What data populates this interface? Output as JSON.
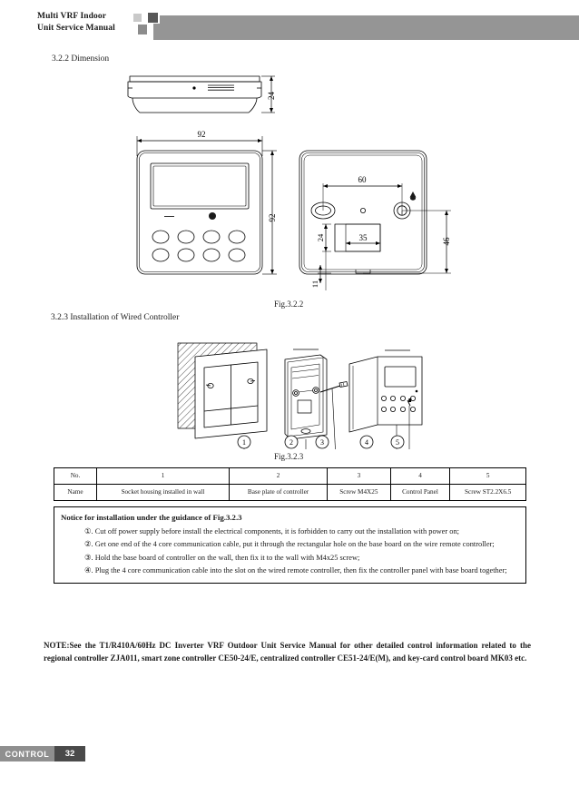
{
  "header": {
    "title_line1": "Multi VRF Indoor",
    "title_line2": "Unit Service Manual"
  },
  "sections": {
    "dimension_heading": "3.2.2 Dimension",
    "installation_heading": "3.2.3 Installation of Wired Controller"
  },
  "figures": {
    "fig_322_caption": "Fig.3.2.2",
    "fig_323_caption": "Fig.3.2.3"
  },
  "dimensions": {
    "side_thickness": "24",
    "front_width": "92",
    "front_height": "92",
    "back_hole_spacing": "60",
    "back_rect_width": "35",
    "back_rect_offset_top": "24",
    "back_right_height": "46",
    "back_bottom_offset": "11"
  },
  "callouts": [
    "1",
    "2",
    "3",
    "4",
    "5"
  ],
  "parts_table": {
    "row_no_label": "No.",
    "row_name_label": "Name",
    "numbers": [
      "1",
      "2",
      "3",
      "4",
      "5"
    ],
    "names": [
      "Socket housing installed in wall",
      "Base plate of controller",
      "Screw M4X25",
      "Control Panel",
      "Screw ST2.2X6.5"
    ]
  },
  "notice": {
    "title": "Notice for installation under the guidance of Fig.3.2.3",
    "items": [
      "①. Cut off power supply before install the electrical components, it is forbidden to carry out the installation with power on;",
      "②. Get one end of the 4 core communication cable, put it through the rectangular hole on the base board on the wire remote controller;",
      "③. Hold the base board of controller on the wall, then fix it to the wall with M4x25 screw;",
      "④. Plug the 4 core communication cable into the slot on the wired remote controller, then fix the controller panel with base board together;"
    ]
  },
  "note": {
    "text": "NOTE:See the T1/R410A/60Hz DC Inverter VRF Outdoor Unit Service Manual for other detailed control information related to the regional controller ZJA011, smart zone controller CE50-24/E, centralized controller CE51-24/E(M), and key-card control board MK03 etc."
  },
  "footer": {
    "chapter_label": "CONTROL",
    "page_number": "32"
  },
  "colors": {
    "header_bar": "#959595",
    "footer_chapter": "#8f8f8f",
    "footer_page": "#4a4a4a",
    "line": "#000000"
  }
}
